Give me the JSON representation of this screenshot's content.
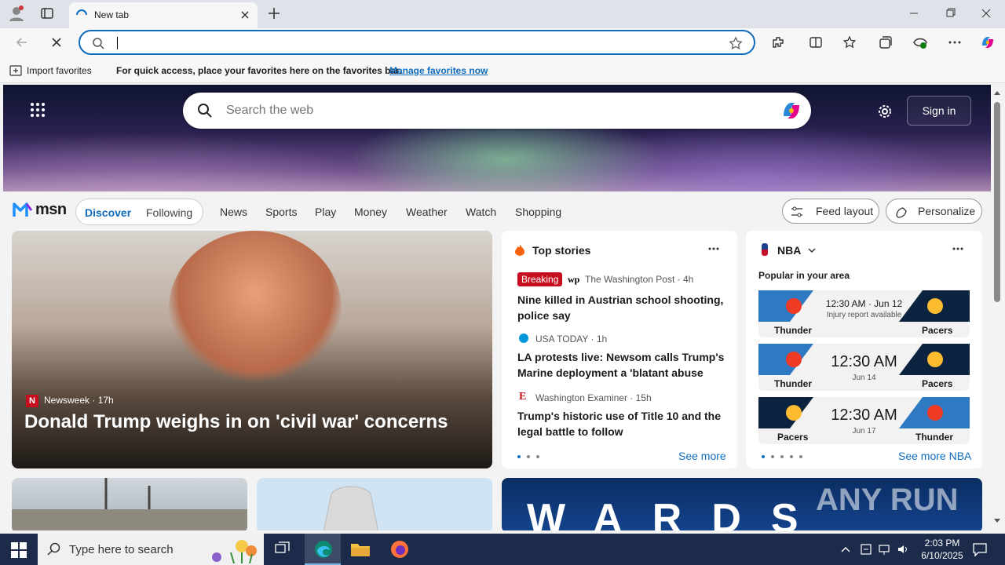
{
  "browser": {
    "tab_title": "New tab",
    "address_value": "",
    "favorites_bar": {
      "import_label": "Import favorites",
      "tip": "For quick access, place your favorites here on the favorites bar.",
      "manage_link": "Manage favorites now"
    }
  },
  "msn": {
    "search_placeholder": "Search the web",
    "sign_in": "Sign in",
    "logo_text": "msn",
    "tabs": {
      "discover": "Discover",
      "following": "Following"
    },
    "nav_links": [
      "News",
      "Sports",
      "Play",
      "Money",
      "Weather",
      "Watch",
      "Shopping"
    ],
    "feed_layout": "Feed layout",
    "personalize": "Personalize"
  },
  "hero_story": {
    "source": "Newsweek",
    "age": "17h",
    "headline": "Donald Trump weighs in on 'civil war' concerns"
  },
  "top_stories": {
    "title": "Top stories",
    "see_more": "See more",
    "items": [
      {
        "badge": "Breaking",
        "source": "The Washington Post",
        "age": "4h",
        "headline": "Nine killed in Austrian school shooting, police say"
      },
      {
        "source": "USA TODAY",
        "age": "1h",
        "headline": "LA protests live: Newsom calls Trump's Marine deployment a 'blatant abuse of..."
      },
      {
        "source": "Washington Examiner",
        "age": "15h",
        "headline": "Trump's historic use of Title 10 and the legal battle to follow"
      }
    ]
  },
  "nba": {
    "title": "NBA",
    "subtitle": "Popular in your area",
    "see_more": "See more NBA",
    "games": [
      {
        "home": "Thunder",
        "away": "Pacers",
        "time": "12:30 AM · Jun 12",
        "note": "Injury report available",
        "home_color": "#2f79c2",
        "away_color": "#0c2340"
      },
      {
        "home": "Thunder",
        "away": "Pacers",
        "time": "12:30 AM",
        "date": "Jun 14",
        "home_color": "#2f79c2",
        "away_color": "#0c2340"
      },
      {
        "home": "Pacers",
        "away": "Thunder",
        "time": "12:30 AM",
        "date": "Jun 17",
        "home_color": "#0c2340",
        "away_color": "#2f79c2"
      }
    ]
  },
  "bottom_card_text": "WARDS",
  "watermark": "ANY RUN",
  "taskbar": {
    "search_placeholder": "Type here to search",
    "time": "2:03 PM",
    "date": "6/10/2025"
  },
  "colors": {
    "accent": "#0f6cbd",
    "breaking": "#c50f1f",
    "taskbar": "#1c2b4a"
  }
}
